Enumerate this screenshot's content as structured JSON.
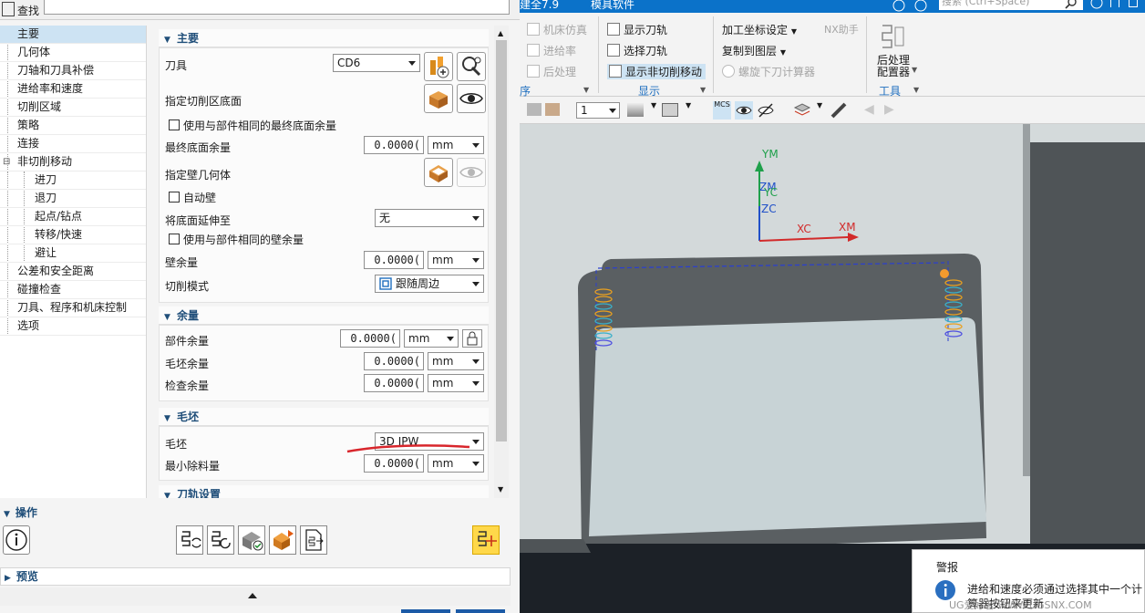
{
  "search": {
    "label": "查找",
    "value": ""
  },
  "nav": {
    "items": [
      {
        "label": "主要",
        "level": 0,
        "selected": true
      },
      {
        "label": "几何体",
        "level": 0
      },
      {
        "label": "刀轴和刀具补偿",
        "level": 0
      },
      {
        "label": "进给率和速度",
        "level": 0
      },
      {
        "label": "切削区域",
        "level": 0
      },
      {
        "label": "策略",
        "level": 0
      },
      {
        "label": "连接",
        "level": 0
      },
      {
        "label": "非切削移动",
        "level": 0,
        "expander": "⊟"
      },
      {
        "label": "进刀",
        "level": 1
      },
      {
        "label": "退刀",
        "level": 1
      },
      {
        "label": "起点/钻点",
        "level": 1
      },
      {
        "label": "转移/快速",
        "level": 1
      },
      {
        "label": "避让",
        "level": 1
      },
      {
        "label": "公差和安全距离",
        "level": 0
      },
      {
        "label": "碰撞检查",
        "level": 0
      },
      {
        "label": "刀具、程序和机床控制",
        "level": 0
      },
      {
        "label": "选项",
        "level": 0
      }
    ]
  },
  "main_section": {
    "title": "主要",
    "tool_label": "刀具",
    "tool_value": "CD6",
    "floor_label": "指定切削区底面",
    "use_final_floor_label": "使用与部件相同的最终底面余量",
    "final_floor_label": "最终底面余量",
    "final_floor_value": "0.0000(",
    "final_floor_unit": "mm",
    "wall_geom_label": "指定壁几何体",
    "auto_wall_label": "自动壁",
    "extend_floor_label": "将底面延伸至",
    "extend_floor_value": "无",
    "use_wall_stock_label": "使用与部件相同的壁余量",
    "wall_stock_label": "壁余量",
    "wall_stock_value": "0.0000(",
    "wall_stock_unit": "mm",
    "cut_mode_label": "切削模式",
    "cut_mode_value": "跟随周边"
  },
  "stock_section": {
    "title": "余量",
    "part_label": "部件余量",
    "part_value": "0.0000(",
    "part_unit": "mm",
    "blank_label": "毛坯余量",
    "blank_value": "0.0000(",
    "blank_unit": "mm",
    "check_label": "检查余量",
    "check_value": "0.0000(",
    "check_unit": "mm"
  },
  "blank_section": {
    "title": "毛坯",
    "blank_label": "毛坯",
    "blank_value": "3D IPW",
    "min_removal_label": "最小除料量",
    "min_removal_value": "0.0000(",
    "min_removal_unit": "mm"
  },
  "path_section": {
    "title": "刀轨设置"
  },
  "operations": {
    "title": "操作"
  },
  "preview": {
    "title": "预览"
  },
  "titlebar": {
    "left_text": "建全7.9",
    "center_text": "模具软件",
    "search_placeholder": "搜索 (Ctrl+Space)"
  },
  "ribbon": {
    "left_items": [
      "机床仿真",
      "进给率",
      "后处理"
    ],
    "display_items": [
      "显示刀轨",
      "选择刀轨",
      "显示非切削移动"
    ],
    "display_group": "显示",
    "csys_item": "加工坐标设定",
    "copy_layer_item": "复制到图层",
    "helix_item": "螺旋下刀计算器",
    "nx_helper": "NX助手",
    "post_config_line1": "后处理",
    "post_config_line2": "配置器",
    "tools_group": "工具",
    "left_group_fragment": "序"
  },
  "toolbar2": {
    "layer_value": "1",
    "mcs_label": "MCS"
  },
  "viewport": {
    "axes": {
      "ym": "YM",
      "zm": "ZM",
      "yc": "YC",
      "zc": "ZC",
      "xc": "XC",
      "xm": "XM"
    }
  },
  "alert": {
    "title": "警报",
    "message_line1": "进给和速度必须通过选择其中一个计",
    "message_line2": "算器按钮来更新",
    "watermark": "UG爱好者 WWW.UGSNX.COM"
  },
  "colors": {
    "accent": "#1f6fbf",
    "titlebar": "#0b72c9",
    "axis_green": "#1ea04a",
    "axis_blue": "#2050c8",
    "axis_red": "#d22a2a"
  }
}
